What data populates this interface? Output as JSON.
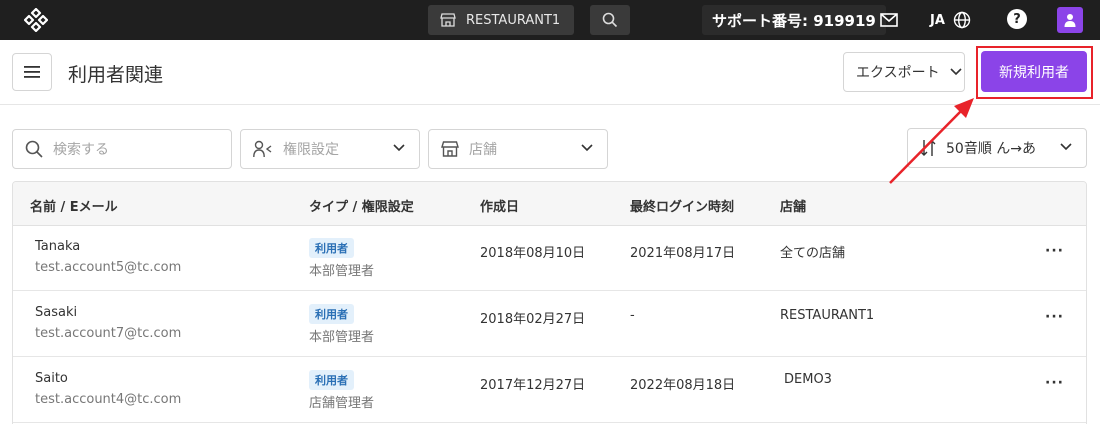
{
  "topbar": {
    "store_name": "RESTAURANT1",
    "support_label": "サポート番号: 919919",
    "language": "JA",
    "help_label": "?"
  },
  "header": {
    "title": "利用者関連",
    "export_label": "エクスポート",
    "new_user_label": "新規利用者"
  },
  "filters": {
    "search_placeholder": "検索する",
    "role_placeholder": "権限設定",
    "store_placeholder": "店舗",
    "sort_label": "50音順 ん→あ"
  },
  "table": {
    "columns": [
      "名前 / Eメール",
      "タイプ / 権限設定",
      "作成日",
      "最終ログイン時刻",
      "店舗"
    ],
    "rows": [
      {
        "name": "Tanaka",
        "email": "test.account5@tc.com",
        "type": "利用者",
        "role": "本部管理者",
        "created": "2018年08月10日",
        "last_login": "2021年08月17日",
        "store": "全ての店舗"
      },
      {
        "name": "Sasaki",
        "email": "test.account7@tc.com",
        "type": "利用者",
        "role": "本部管理者",
        "created": "2018年02月27日",
        "last_login": "-",
        "store": "RESTAURANT1"
      },
      {
        "name": "Saito",
        "email": "test.account4@tc.com",
        "type": "利用者",
        "role": "店舗管理者",
        "created": "2017年12月27日",
        "last_login": "2022年08月18日",
        "store": "DEMO3"
      }
    ],
    "more_label": "···"
  },
  "colors": {
    "accent": "#8b44e8",
    "highlight": "#e8232a",
    "topbar": "#1f1f1f"
  }
}
